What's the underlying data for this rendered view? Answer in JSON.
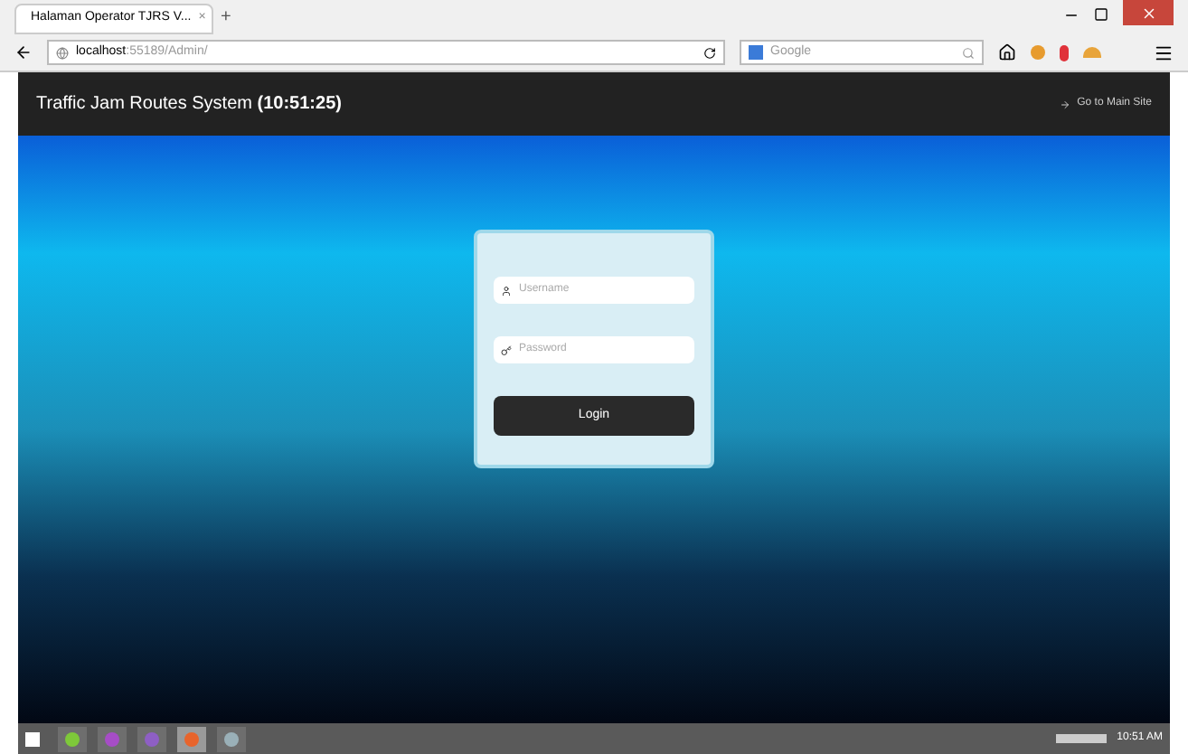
{
  "browser": {
    "tab_title": "Halaman Operator TJRS V...",
    "tab_close": "×",
    "new_tab": "+",
    "url_host": "localhost",
    "url_path": ":55189/Admin/",
    "search_placeholder": "Google"
  },
  "header": {
    "title": "Traffic Jam Routes System **(10:51:25)**",
    "link": "Go to Main Site"
  },
  "login": {
    "username_placeholder": "Username",
    "password_placeholder": "Password",
    "button": "Login"
  },
  "taskbar": {
    "clock": "10:51 AM",
    "apps": [
      {
        "color": "#7ec83a",
        "selected": false
      },
      {
        "color": "#a64dc6",
        "selected": false
      },
      {
        "color": "#8e5fc4",
        "selected": false
      },
      {
        "color": "#e8642c",
        "selected": true
      },
      {
        "color": "#9ab0b8",
        "selected": false
      }
    ]
  }
}
